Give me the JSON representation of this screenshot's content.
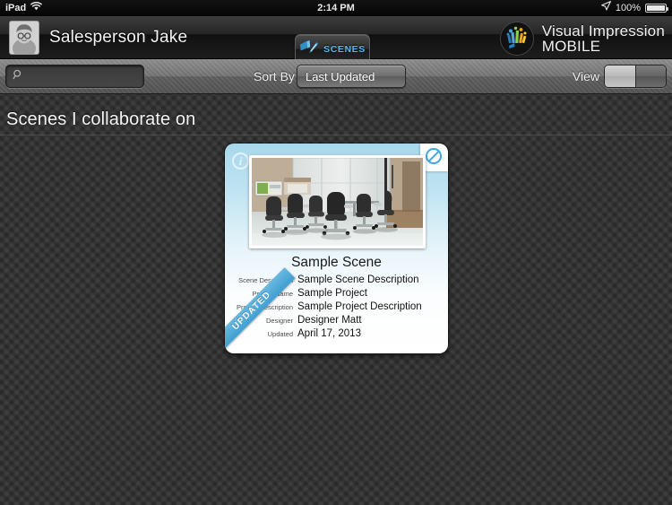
{
  "statusbar": {
    "device": "iPad",
    "wifi_icon": "wifi-icon",
    "time": "2:14 PM",
    "location_icon": "location-arrow-icon",
    "battery_percent": "100%",
    "battery_icon": "battery-full-icon"
  },
  "header": {
    "avatar_name": "avatar",
    "user_name": "Salesperson Jake",
    "scenes_button": {
      "label": "SCENES",
      "icon": "scenes-icon",
      "accent": "#5bb8e8"
    },
    "logo": {
      "icon": "visual-impression-logo-icon",
      "line1": "Visual Impression",
      "line2": "MOBILE"
    }
  },
  "toolbar": {
    "search": {
      "icon": "search-icon",
      "value": "",
      "placeholder": ""
    },
    "sort_by_label": "Sort By",
    "sort_by_value": "Last Updated",
    "sort_by_options": [
      "Last Updated"
    ],
    "view_label": "View",
    "view_segments": [
      "grid-view",
      "list-view"
    ],
    "view_selected_index": 0
  },
  "main": {
    "page_title": "Scenes I collaborate on",
    "cards": [
      {
        "info_icon": "info-icon",
        "block_icon": "no-entry-icon",
        "photo_alt": "conference-room-office-chairs",
        "title": "Sample Scene",
        "ribbon": "UPDATED",
        "fields": [
          {
            "label": "Scene Description",
            "value": "Sample Scene Description"
          },
          {
            "label": "Project Name",
            "value": "Sample Project"
          },
          {
            "label": "Project Description",
            "value": "Sample Project Description"
          },
          {
            "label": "Designer",
            "value": "Designer Matt"
          },
          {
            "label": "Updated",
            "value": "April 17, 2013"
          }
        ]
      }
    ]
  },
  "colors": {
    "accent_blue": "#3fa9dd",
    "scenes_blue": "#5bb8e8",
    "card_top": "#a8d8ec",
    "background": "#343434"
  }
}
